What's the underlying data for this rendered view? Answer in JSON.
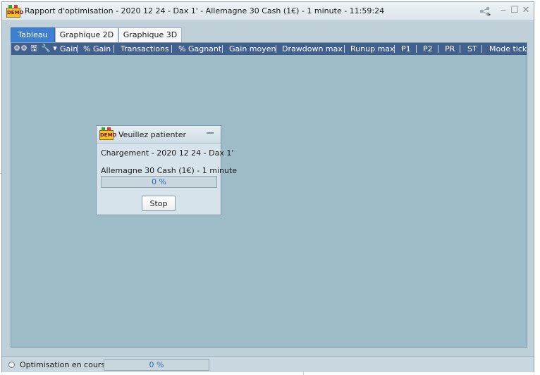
{
  "window": {
    "title": "Rapport d'optimisation - 2020 12 24 - Dax 1' - Allemagne 30 Cash (1€) - 1 minute - 11:59:24",
    "icon": "demo-icon",
    "controls": [
      "share-icon",
      "minimize-icon",
      "maximize-icon",
      "close-icon"
    ]
  },
  "tabs": [
    {
      "label": "Tableau",
      "active": true
    },
    {
      "label": "Graphique 2D",
      "active": false
    },
    {
      "label": "Graphique 3D",
      "active": false
    }
  ],
  "table": {
    "tool_icons": [
      "gear-icon",
      "save-icon",
      "wrench-icon",
      "dropdown-arrow-icon"
    ],
    "columns": [
      "Gain",
      "% Gain",
      "Transactions",
      "% Gagnant",
      "Gain moyen",
      "Drawdown max",
      "Runup max",
      "P1",
      "P2",
      "PR",
      "ST",
      "Mode tick"
    ]
  },
  "dialog": {
    "title": "Veuillez patienter",
    "line1": "Chargement - 2020 12 24 - Dax 1'",
    "line2": "Allemagne 30 Cash (1€) - 1 minute",
    "progress_label": "0 %",
    "progress_value": 0,
    "stop_label": "Stop"
  },
  "status": {
    "text": "Optimisation en cours...",
    "progress_label": "0 %",
    "progress_value": 0
  },
  "colors": {
    "accent": "#3d7fd1",
    "header": "#41608e",
    "panel": "#9ebbc8"
  }
}
